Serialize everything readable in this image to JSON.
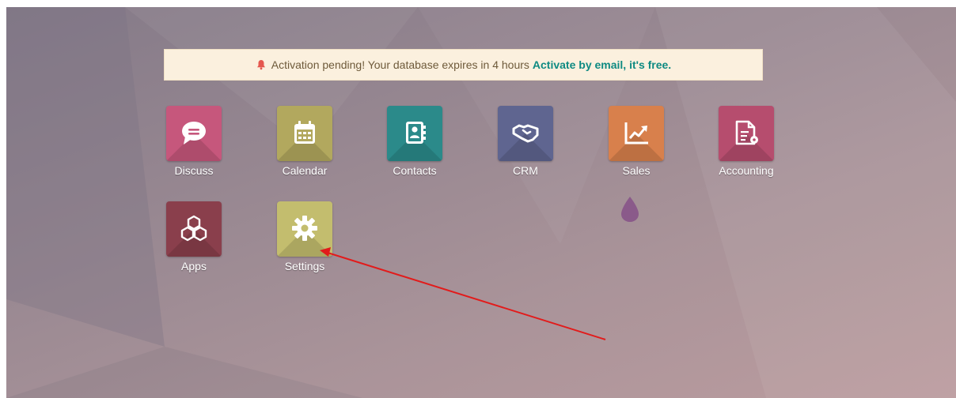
{
  "banner": {
    "icon": "bell-icon",
    "message": "Activation pending! Your database expires in 4 hours",
    "link_text": "Activate by email, it's free."
  },
  "apps": [
    {
      "label": "Discuss",
      "icon": "chat-bubble-icon",
      "color": "#c6577c"
    },
    {
      "label": "Calendar",
      "icon": "calendar-icon",
      "color": "#b2a85e"
    },
    {
      "label": "Contacts",
      "icon": "address-book-icon",
      "color": "#2b8a8a"
    },
    {
      "label": "CRM",
      "icon": "handshake-icon",
      "color": "#5f6590"
    },
    {
      "label": "Sales",
      "icon": "trending-chart-icon",
      "color": "#d8804c"
    },
    {
      "label": "Accounting",
      "icon": "invoice-gear-icon",
      "color": "#b64d6e"
    },
    {
      "label": "Apps",
      "icon": "cubes-icon",
      "color": "#8a3f4c"
    },
    {
      "label": "Settings",
      "icon": "gear-icon",
      "color": "#c3bd6e"
    }
  ],
  "colors": {
    "banner_link": "#0e8a82",
    "bell": "#e5574e",
    "annotation_arrow": "#e21b1b"
  }
}
